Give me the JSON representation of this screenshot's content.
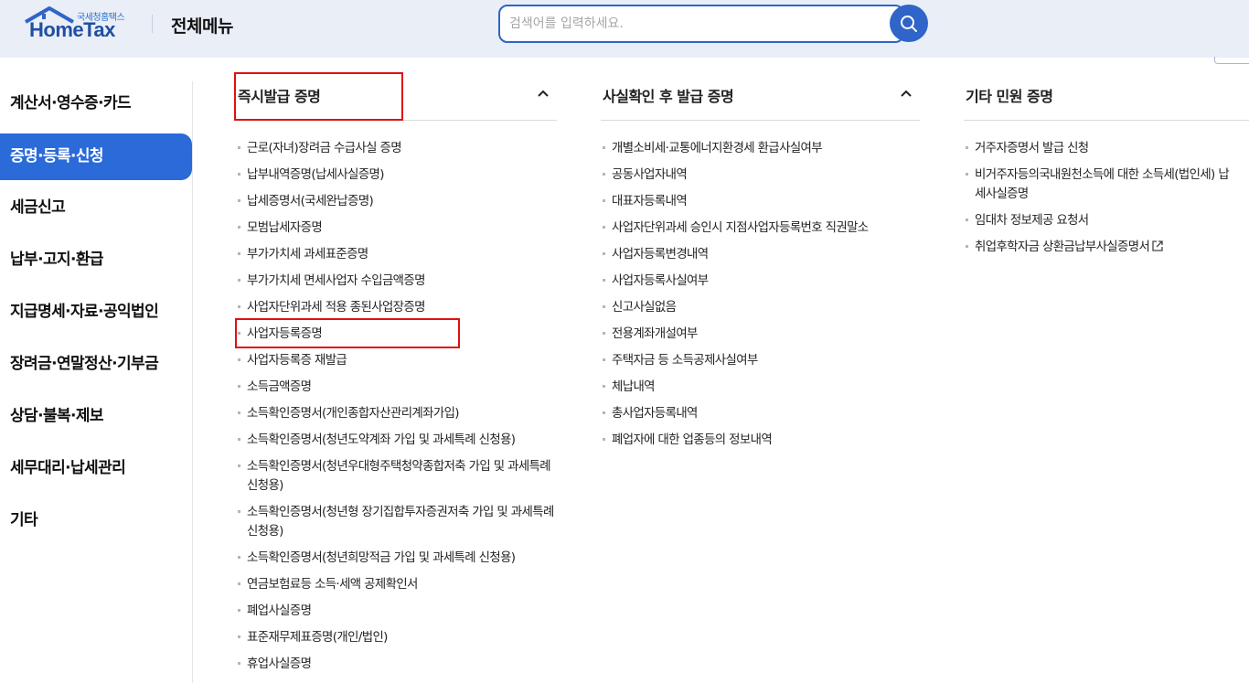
{
  "header": {
    "logo_small": "국세청홈택스",
    "logo_main": "HomeTax",
    "title": "전체메뉴",
    "search_placeholder": "검색어를 입력하세요."
  },
  "sidebar": {
    "items": [
      {
        "label": "계산서·영수증·카드",
        "active": false
      },
      {
        "label": "증명·등록·신청",
        "active": true
      },
      {
        "label": "세금신고",
        "active": false
      },
      {
        "label": "납부·고지·환급",
        "active": false
      },
      {
        "label": "지급명세·자료·공익법인",
        "active": false
      },
      {
        "label": "장려금·연말정산·기부금",
        "active": false
      },
      {
        "label": "상담·불복·제보",
        "active": false
      },
      {
        "label": "세무대리·납세관리",
        "active": false
      },
      {
        "label": "기타",
        "active": false
      }
    ]
  },
  "columns": [
    {
      "title": "즉시발급 증명",
      "items": [
        "근로(자녀)장려금 수급사실 증명",
        "납부내역증명(납세사실증명)",
        "납세증명서(국세완납증명)",
        "모범납세자증명",
        "부가가치세 과세표준증명",
        "부가가치세 면세사업자 수입금액증명",
        "사업자단위과세 적용 종된사업장증명",
        "사업자등록증명",
        "사업자등록증 재발급",
        "소득금액증명",
        "소득확인증명서(개인종합자산관리계좌가입)",
        "소득확인증명서(청년도약계좌 가입 및 과세특례 신청용)",
        "소득확인증명서(청년우대형주택청약종합저축 가입 및 과세특례 신청용)",
        "소득확인증명서(청년형 장기집합투자증권저축 가입 및 과세특례 신청용)",
        "소득확인증명서(청년희망적금 가입 및 과세특례 신청용)",
        "연금보험료등 소득·세액 공제확인서",
        "폐업사실증명",
        "표준재무제표증명(개인/법인)",
        "휴업사실증명"
      ]
    },
    {
      "title": "사실확인 후 발급 증명",
      "items": [
        "개별소비세·교통에너지환경세 환급사실여부",
        "공동사업자내역",
        "대표자등록내역",
        "사업자단위과세 승인시 지점사업자등록번호 직권말소",
        "사업자등록변경내역",
        "사업자등록사실여부",
        "신고사실없음",
        "전용계좌개설여부",
        "주택자금 등 소득공제사실여부",
        "체납내역",
        "총사업자등록내역",
        "폐업자에 대한 업종등의 정보내역"
      ]
    },
    {
      "title": "기타 민원 증명",
      "items": [
        "거주자증명서 발급 신청",
        "비거주자등의국내원천소득에 대한 소득세(법인세) 납세사실증명",
        "임대차 정보제공 요청서",
        "취업후학자금 상환금납부사실증명서"
      ]
    }
  ],
  "colors": {
    "accent": "#2a6ad9",
    "header_bg": "#e9eef7",
    "highlight": "#e01010"
  }
}
